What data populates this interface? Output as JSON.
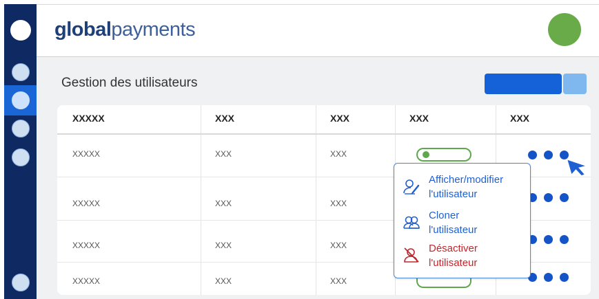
{
  "header": {
    "logo_bold": "global",
    "logo_light": "payments"
  },
  "page": {
    "title": "Gestion des utilisateurs"
  },
  "table": {
    "headers": [
      "XXXXX",
      "XXX",
      "XXX",
      "XXX",
      "XXX"
    ],
    "rows": [
      [
        "XXXXX",
        "XXX",
        "XXX"
      ],
      [
        "XXXXX",
        "XXX",
        "XXX"
      ],
      [
        "XXXXX",
        "XXX",
        "XXX"
      ],
      [
        "XXXXX",
        "XXX",
        "XXX"
      ]
    ]
  },
  "row_menu": {
    "items": [
      {
        "line1": "Afficher/modifier",
        "line2": "l'utilisateur",
        "icon": "user-edit-icon"
      },
      {
        "line1": "Cloner",
        "line2": "l'utilisateur",
        "icon": "users-clone-icon"
      },
      {
        "line1": "Désactiver",
        "line2": "l'utilisateur",
        "icon": "user-disable-icon"
      }
    ]
  },
  "colors": {
    "sidebar": "#0f2a63",
    "accent": "#1561d8",
    "status_green": "#5ea74a",
    "danger": "#c0262b",
    "avatar": "#6aab49"
  }
}
